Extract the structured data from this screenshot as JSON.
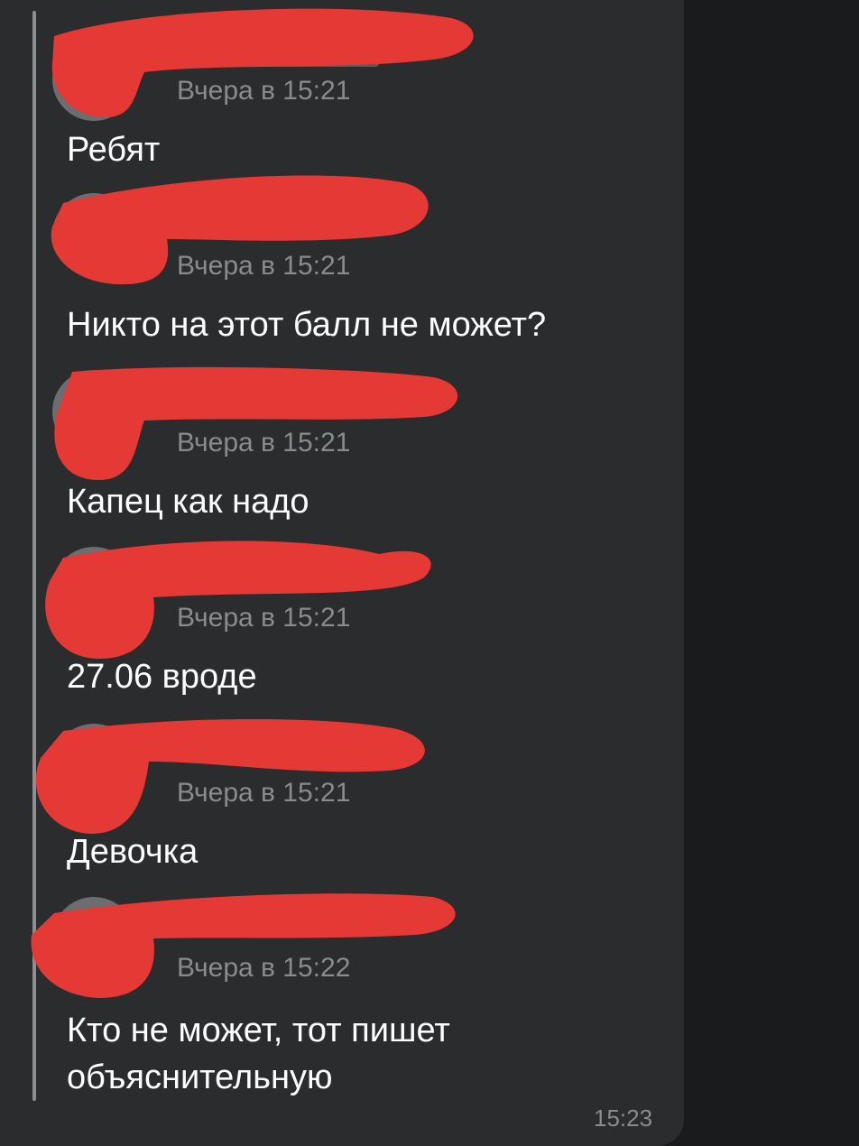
{
  "messages": [
    {
      "time": "Вчера в 15:21",
      "text": "Ребят"
    },
    {
      "time": "Вчера в 15:21",
      "text": "Никто на этот балл не может?"
    },
    {
      "time": "Вчера в 15:21",
      "text": "Капец как надо"
    },
    {
      "time": "Вчера в 15:21",
      "text": "27.06 вроде"
    },
    {
      "time": "Вчера в 15:21",
      "text": "Девочка"
    },
    {
      "time": "Вчера в 15:22",
      "text": "Кто не может, тот пишет\nобъяснительную"
    }
  ],
  "bubble_time": "15:23",
  "colors": {
    "background": "#1a1b1d",
    "bubble": "#2b2c2e",
    "redaction": "#e53935",
    "text": "#ffffff",
    "muted": "#8a8b8d"
  }
}
